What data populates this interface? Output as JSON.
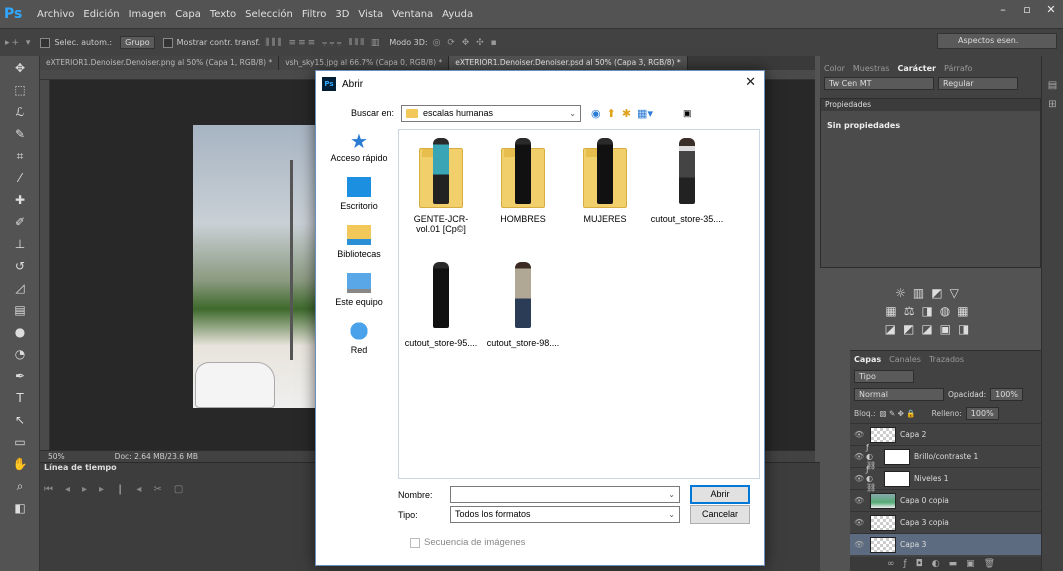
{
  "app": {
    "logo": "Ps",
    "menu": [
      "Archivo",
      "Edición",
      "Imagen",
      "Capa",
      "Texto",
      "Selección",
      "Filtro",
      "3D",
      "Vista",
      "Ventana",
      "Ayuda"
    ],
    "window_controls": [
      "–",
      "▫",
      "✕"
    ]
  },
  "options_bar": {
    "auto_select_label": "Selec. autom.:",
    "group_value": "Grupo",
    "transform_label": "Mostrar contr. transf.",
    "mode3d_label": "Modo 3D:",
    "workspace": "Aspectos esen."
  },
  "tabs": [
    {
      "label": "eXTERIOR1.Denoiser.Denoiser.png al 50% (Capa 1, RGB/8) *",
      "active": false
    },
    {
      "label": "vsh_sky15.jpg al 66.7% (Capa 0, RGB/8) *",
      "active": false
    },
    {
      "label": "eXTERIOR1.Denoiser.Denoiser.psd al 50% (Capa 3, RGB/8) *",
      "active": true
    }
  ],
  "status": {
    "zoom": "50%",
    "doc": "Doc: 2.64 MB/23.6 MB"
  },
  "timeline": {
    "title": "Línea de tiempo"
  },
  "char_panel": {
    "tabs": [
      "Color",
      "Muestras",
      "Carácter",
      "Párrafo"
    ],
    "font": "Tw Cen MT",
    "style": "Regular"
  },
  "properties": {
    "title": "Propiedades",
    "body": "Sin propiedades"
  },
  "layers": {
    "tabs": [
      "Capas",
      "Canales",
      "Trazados"
    ],
    "filter": "Tipo",
    "blend": "Normal",
    "opacity_label": "Opacidad:",
    "opacity": "100%",
    "lock_label": "Bloq.:",
    "fill_label": "Relleno:",
    "fill": "100%",
    "items": [
      {
        "name": "Capa 2",
        "thumb": "checker",
        "adj": false,
        "selected": false
      },
      {
        "name": "Brillo/contraste 1",
        "thumb": "white",
        "adj": true,
        "selected": false
      },
      {
        "name": "Niveles 1",
        "thumb": "white",
        "adj": true,
        "selected": false
      },
      {
        "name": "Capa 0 copia",
        "thumb": "photo",
        "adj": false,
        "selected": false
      },
      {
        "name": "Capa 3 copia",
        "thumb": "checker",
        "adj": false,
        "selected": false
      },
      {
        "name": "Capa 3",
        "thumb": "checker",
        "adj": false,
        "selected": true
      }
    ]
  },
  "dialog": {
    "title": "Abrir",
    "look_in_label": "Buscar en:",
    "look_in_value": "escalas humanas",
    "sidebar": [
      {
        "label": "Acceso rápido",
        "icon": "star-icon"
      },
      {
        "label": "Escritorio",
        "icon": "desktop-icon"
      },
      {
        "label": "Bibliotecas",
        "icon": "library-icon"
      },
      {
        "label": "Este equipo",
        "icon": "computer-icon"
      },
      {
        "label": "Red",
        "icon": "network-icon"
      }
    ],
    "files": [
      {
        "label": "GENTE-JCR- vol.01 [Cp©]",
        "kind": "folder"
      },
      {
        "label": "HOMBRES",
        "kind": "folder"
      },
      {
        "label": "MUJERES",
        "kind": "folder"
      },
      {
        "label": "cutout_store-35....",
        "kind": "image"
      },
      {
        "label": "cutout_store-95....",
        "kind": "image"
      },
      {
        "label": "cutout_store-98....",
        "kind": "image"
      }
    ],
    "name_label": "Nombre:",
    "name_value": "",
    "type_label": "Tipo:",
    "type_value": "Todos los formatos",
    "open_button": "Abrir",
    "cancel_button": "Cancelar",
    "sequence_label": "Secuencia de imágenes"
  }
}
